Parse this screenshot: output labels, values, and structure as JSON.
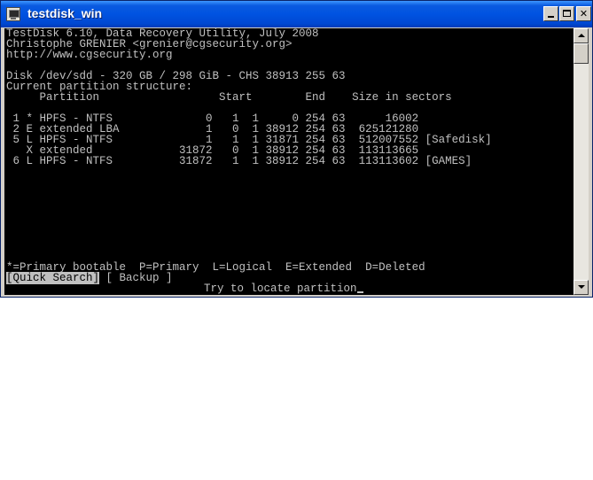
{
  "window": {
    "title": "testdisk_win",
    "icon": "console-app-icon",
    "accent_color": "#0054e3"
  },
  "console": {
    "header_line1": "TestDisk 6.10, Data Recovery Utility, July 2008",
    "header_line2": "Christophe GRENIER <grenier@cgsecurity.org>",
    "header_line3": "http://www.cgsecurity.org",
    "disk_line": "Disk /dev/sdd - 320 GB / 298 GiB - CHS 38913 255 63",
    "structure_title": "Current partition structure:",
    "column_header": "     Partition                  Start        End    Size in sectors",
    "partitions": [
      " 1 * HPFS - NTFS              0   1  1     0 254 63      16002",
      " 2 E extended LBA             1   0  1 38912 254 63  625121280",
      " 5 L HPFS - NTFS              1   1  1 31871 254 63  512007552 [Safedisk]",
      "   X extended             31872   0  1 38912 254 63  113113665",
      " 6 L HPFS - NTFS          31872   1  1 38912 254 63  113113602 [GAMES]"
    ],
    "legend": "*=Primary bootable  P=Primary  L=Logical  E=Extended  D=Deleted",
    "menu_quick_search": "[Quick Search]",
    "menu_backup": " [ Backup ]",
    "hint": "Try to locate partition",
    "text_color": "#c0c0c0",
    "background_color": "#000000"
  }
}
